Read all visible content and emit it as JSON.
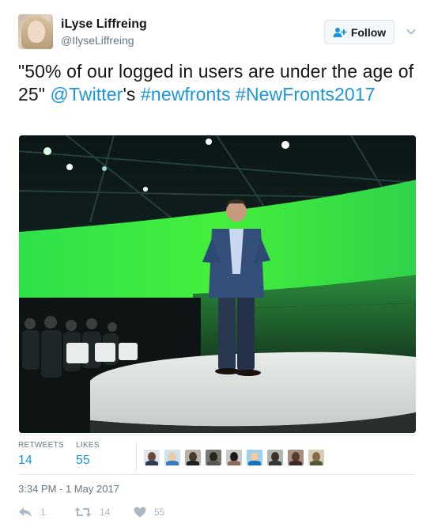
{
  "user": {
    "full_name": "iLyse Liffreing",
    "screen_name": "@IlyseLiffreing"
  },
  "follow_button": {
    "label": "Follow"
  },
  "tweet": {
    "text_prefix": "\"50% of our logged in users are under the age of 25\" ",
    "mention": "@Twitter",
    "text_middle": "'s ",
    "hashtag1": "#newfronts",
    "space": " ",
    "hashtag2": "#NewFronts2017"
  },
  "stats": {
    "retweets_label": "RETWEETS",
    "retweets_value": "14",
    "likes_label": "LIKES",
    "likes_value": "55"
  },
  "timestamp": "3:34 PM - 1 May 2017",
  "actions": {
    "reply_count": "1",
    "retweet_count": "14",
    "like_count": "55"
  },
  "colors": {
    "link": "#1b95e0",
    "secondary_text": "#657786",
    "action_icon": "#aab8c2",
    "divider": "#e1e8ed"
  },
  "icons": [
    "follow-person-plus-icon",
    "caret-down-icon",
    "reply-icon",
    "retweet-icon",
    "like-heart-icon"
  ]
}
